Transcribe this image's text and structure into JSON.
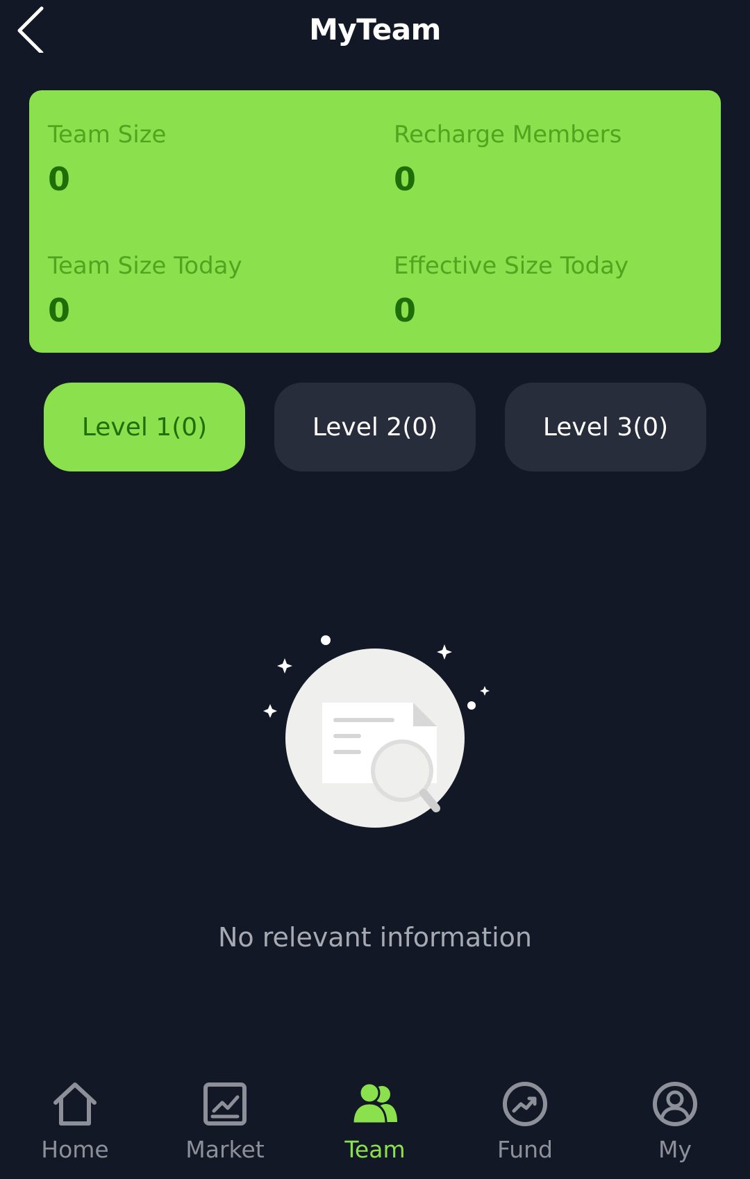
{
  "header": {
    "title": "MyTeam",
    "back_icon": "chevron-left-icon"
  },
  "stats": {
    "team_size": {
      "label": "Team Size",
      "value": "0"
    },
    "recharge_members": {
      "label": "Recharge Members",
      "value": "0"
    },
    "team_size_today": {
      "label": "Team Size Today",
      "value": "0"
    },
    "effective_size_today": {
      "label": "Effective Size Today",
      "value": "0"
    }
  },
  "levels": [
    {
      "label": "Level 1(0)",
      "active": true
    },
    {
      "label": "Level 2(0)",
      "active": false
    },
    {
      "label": "Level 3(0)",
      "active": false
    }
  ],
  "empty_state": {
    "text": "No relevant information",
    "icon": "empty-document-search-icon"
  },
  "tabbar": {
    "items": [
      {
        "label": "Home",
        "icon": "home-icon"
      },
      {
        "label": "Market",
        "icon": "market-chart-icon"
      },
      {
        "label": "Team",
        "icon": "team-icon",
        "active": true
      },
      {
        "label": "Fund",
        "icon": "fund-trend-icon"
      },
      {
        "label": "My",
        "icon": "user-profile-icon"
      }
    ]
  },
  "colors": {
    "background": "#131826",
    "accent": "#8be04e",
    "stat_label": "#4fa51e",
    "stat_value": "#1d6e08",
    "inactive_button": "#282d3b",
    "tab_inactive": "#8d9099"
  }
}
